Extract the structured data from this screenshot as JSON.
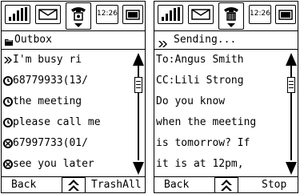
{
  "left_screen": {
    "status": {
      "time": "12:26",
      "icons": [
        "signal-icon",
        "envelope-icon",
        "phone-icon",
        "clock-icon",
        "battery-icon"
      ]
    },
    "title": "Outbox",
    "title_icon": "folder-icon",
    "messages": [
      {
        "icon": "double-arrow-icon",
        "text": "I'm busy ri"
      },
      {
        "icon": "clock-icon",
        "text": "68779933(13/"
      },
      {
        "icon": "clock-icon",
        "text": "the meeting"
      },
      {
        "icon": "clock-icon",
        "text": "please call me"
      },
      {
        "icon": "failed-icon",
        "text": "67997733(01/"
      },
      {
        "icon": "failed-icon",
        "text": "see you later"
      }
    ],
    "softkeys": {
      "left": "Back",
      "right": "TrashAll"
    }
  },
  "right_screen": {
    "status": {
      "time": "12:26",
      "icons": [
        "signal-icon",
        "envelope-icon",
        "phone-icon",
        "clock-icon",
        "battery-icon"
      ]
    },
    "title": "Sending...",
    "title_icon": "double-arrow-icon",
    "lines": [
      "To:Angus Smith",
      "CC:Lili Strong",
      "Do you know",
      "when the meeting",
      "is tomorrow? If",
      "it is at 12pm,"
    ],
    "softkeys": {
      "left": "Back",
      "right": "Stop"
    }
  }
}
